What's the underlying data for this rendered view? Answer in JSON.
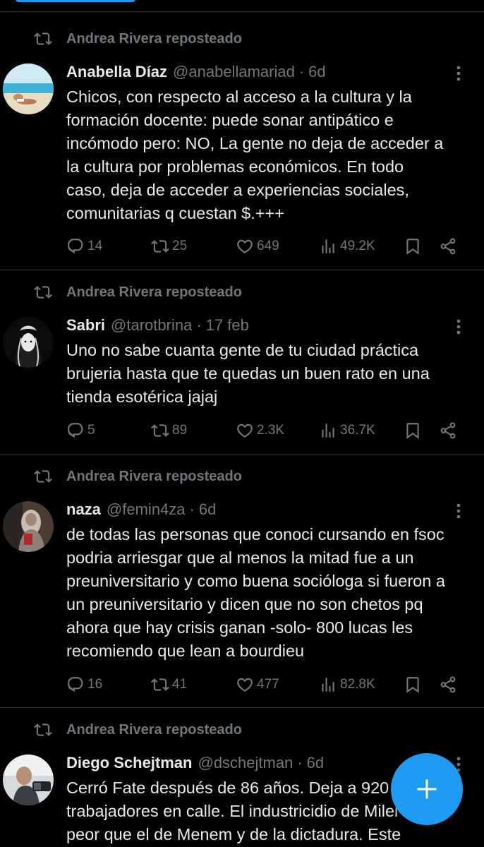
{
  "reposter_text": "Andrea Rivera reposteado",
  "posts": [
    {
      "name": "Anabella Díaz",
      "handle": "@anabellamariad",
      "time": "6d",
      "lines": [
        "Chicos, con respecto al acceso a la cultura y la",
        "formación docente: puede sonar antipático e",
        "incómodo pero: NO, La gente no deja de acceder a",
        "la cultura por problemas económicos. En todo",
        "caso, deja de acceder a experiencias sociales,",
        "comunitarias q cuestan $.+++"
      ],
      "replies": "14",
      "reposts": "25",
      "likes": "649",
      "views": "49.2K"
    },
    {
      "name": "Sabri",
      "handle": "@tarotbrina",
      "time": "17 feb",
      "lines": [
        "Uno no sabe cuanta gente de tu ciudad práctica",
        "brujeria hasta que te quedas un buen rato en una",
        "tienda esotérica jajaj"
      ],
      "replies": "5",
      "reposts": "89",
      "likes": "2.3K",
      "views": "36.7K"
    },
    {
      "name": "naza",
      "handle": "@femin4za",
      "time": "6d",
      "lines": [
        "de todas las personas que conoci cursando en fsoc",
        "podria arriesgar que al menos la mitad fue a un",
        "preuniversitario y como buena socióloga si fueron a",
        "un preuniversitario y dicen que no son chetos pq",
        "ahora que hay crisis ganan -solo- 800 lucas les",
        "recomiendo que lean a bourdieu"
      ],
      "replies": "16",
      "reposts": "41",
      "likes": "477",
      "views": "82.8K"
    },
    {
      "name": "Diego Schejtman",
      "handle": "@dschejtman",
      "time": "6d",
      "lines": [
        "Cerró Fate después de 86 años. Deja a 920",
        "trabajadores en calle. El industricidio de Milei es",
        "peor que el de Menem y de la dictadura. Este"
      ]
    }
  ],
  "icons": {
    "repost": "repost-icon",
    "more": "more-icon",
    "reply": "reply-icon",
    "retweet": "retweet-icon",
    "like": "heart-icon",
    "views": "views-icon",
    "bookmark": "bookmark-icon",
    "share": "share-icon",
    "compose": "plus-icon"
  },
  "colors": {
    "background": "#000000",
    "text": "#e7e9ea",
    "muted": "#71767b",
    "divider": "#2f3336",
    "accent": "#1d9bf0"
  }
}
